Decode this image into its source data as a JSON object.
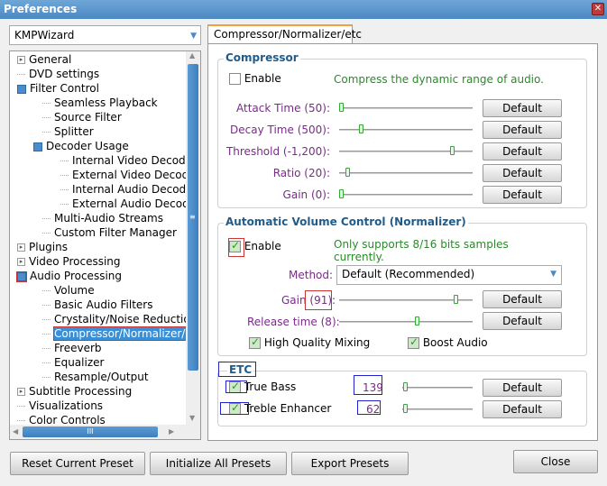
{
  "window": {
    "title": "Preferences",
    "close_icon": "close-icon"
  },
  "preset": {
    "value": "KMPWizard"
  },
  "tree": [
    {
      "label": "General",
      "level": 0,
      "icon": "expand"
    },
    {
      "label": "DVD settings",
      "level": 0,
      "icon": "none"
    },
    {
      "label": "Filter Control",
      "level": 0,
      "icon": "collapse"
    },
    {
      "label": "Seamless Playback",
      "level": 1,
      "icon": "none"
    },
    {
      "label": "Source Filter",
      "level": 1,
      "icon": "none"
    },
    {
      "label": "Splitter",
      "level": 1,
      "icon": "none"
    },
    {
      "label": "Decoder Usage",
      "level": 1,
      "icon": "collapse"
    },
    {
      "label": "Internal Video Decoder",
      "level": 2,
      "icon": "none"
    },
    {
      "label": "External Video Decoder",
      "level": 2,
      "icon": "none"
    },
    {
      "label": "Internal Audio Decoder",
      "level": 2,
      "icon": "none"
    },
    {
      "label": "External Audio Decoder",
      "level": 2,
      "icon": "none"
    },
    {
      "label": "Multi-Audio Streams",
      "level": 1,
      "icon": "none"
    },
    {
      "label": "Custom Filter Manager",
      "level": 1,
      "icon": "none"
    },
    {
      "label": "Plugins",
      "level": 0,
      "icon": "expand"
    },
    {
      "label": "Video Processing",
      "level": 0,
      "icon": "expand"
    },
    {
      "label": "Audio Processing",
      "level": 0,
      "icon": "collapse-marked"
    },
    {
      "label": "Volume",
      "level": 1,
      "icon": "none"
    },
    {
      "label": "Basic Audio Filters",
      "level": 1,
      "icon": "none"
    },
    {
      "label": "Crystality/Noise Reduction",
      "level": 1,
      "icon": "none"
    },
    {
      "label": "Compressor/Normalizer/etc",
      "level": 1,
      "icon": "none",
      "selected": true
    },
    {
      "label": "Freeverb",
      "level": 1,
      "icon": "none"
    },
    {
      "label": "Equalizer",
      "level": 1,
      "icon": "none"
    },
    {
      "label": "Resample/Output",
      "level": 1,
      "icon": "none"
    },
    {
      "label": "Subtitle Processing",
      "level": 0,
      "icon": "expand"
    },
    {
      "label": "Visualizations",
      "level": 0,
      "icon": "none"
    },
    {
      "label": "Color Controls",
      "level": 0,
      "icon": "none"
    }
  ],
  "tab": {
    "label": "Compressor/Normalizer/etc"
  },
  "compressor": {
    "title": "Compressor",
    "enable_label": "Enable",
    "enabled": false,
    "description": "Compress the dynamic range of audio.",
    "sliders": [
      {
        "label": "Attack Time (50):",
        "value": 0.0,
        "button": "Default"
      },
      {
        "label": "Decay Time (500):",
        "value": 0.16,
        "button": "Default"
      },
      {
        "label": "Threshold (-1,200):",
        "value": 0.88,
        "button": "Default"
      },
      {
        "label": "Ratio (20):",
        "value": 0.05,
        "button": "Default"
      },
      {
        "label": "Gain (0):",
        "value": 0.0,
        "button": "Default"
      }
    ]
  },
  "normalizer": {
    "title": "Automatic Volume Control (Normalizer)",
    "enable_label": "Enable",
    "enabled": true,
    "description": "Only supports 8/16 bits samples currently.",
    "method_label": "Method:",
    "method_value": "Default (Recommended)",
    "gain_label_prefix": "Gain ",
    "gain_label_value": "(91):",
    "gain_value": 0.91,
    "release_label": "Release time (8):",
    "release_value": 0.6,
    "default_label": "Default",
    "hq_label": "High Quality Mixing",
    "hq_checked": true,
    "boost_label": "Boost Audio",
    "boost_checked": true
  },
  "etc": {
    "title": "ETC",
    "items": [
      {
        "label": "True Bass",
        "checked": true,
        "value": "139",
        "slider": 0.02,
        "button": "Default"
      },
      {
        "label": "Treble Enhancer",
        "checked": true,
        "value": "62",
        "slider": 0.02,
        "button": "Default"
      }
    ]
  },
  "footer": {
    "reset": "Reset Current Preset",
    "initialize": "Initialize All Presets",
    "export": "Export Presets",
    "close": "Close"
  }
}
